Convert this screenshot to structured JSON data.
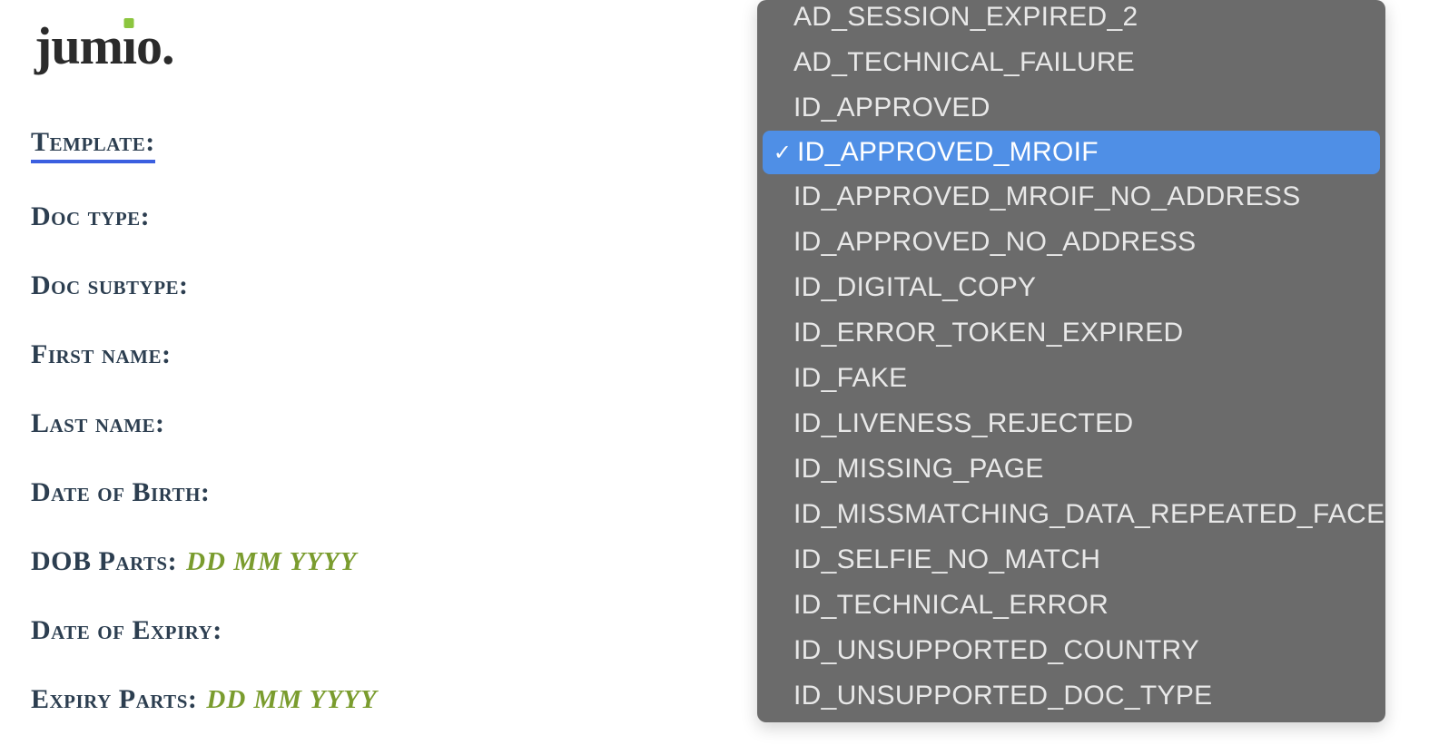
{
  "logo": {
    "text_part1": "jum",
    "text_i": "ı",
    "text_part2": "o",
    "period": "."
  },
  "form": {
    "template_label": "Template:",
    "doc_type_label": "Doc type:",
    "doc_subtype_label": "Doc subtype:",
    "first_name_label": "First name:",
    "last_name_label": "Last name:",
    "dob_label": "Date of Birth:",
    "dob_parts_label": "DOB Parts:",
    "dob_parts_hint": "DD MM YYYY",
    "expiry_label": "Date of Expiry:",
    "expiry_parts_label": "Expiry Parts:",
    "expiry_parts_hint": "DD MM YYYY"
  },
  "dropdown": {
    "selected_value": "ID_APPROVED_MROIF",
    "checkmark": "✓",
    "options": [
      "AD_SESSION_EXPIRED_2",
      "AD_TECHNICAL_FAILURE",
      "ID_APPROVED",
      "ID_APPROVED_MROIF",
      "ID_APPROVED_MROIF_NO_ADDRESS",
      "ID_APPROVED_NO_ADDRESS",
      "ID_DIGITAL_COPY",
      "ID_ERROR_TOKEN_EXPIRED",
      "ID_FAKE",
      "ID_LIVENESS_REJECTED",
      "ID_MISSING_PAGE",
      "ID_MISSMATCHING_DATA_REPEATED_FACE",
      "ID_SELFIE_NO_MATCH",
      "ID_TECHNICAL_ERROR",
      "ID_UNSUPPORTED_COUNTRY",
      "ID_UNSUPPORTED_DOC_TYPE"
    ]
  }
}
